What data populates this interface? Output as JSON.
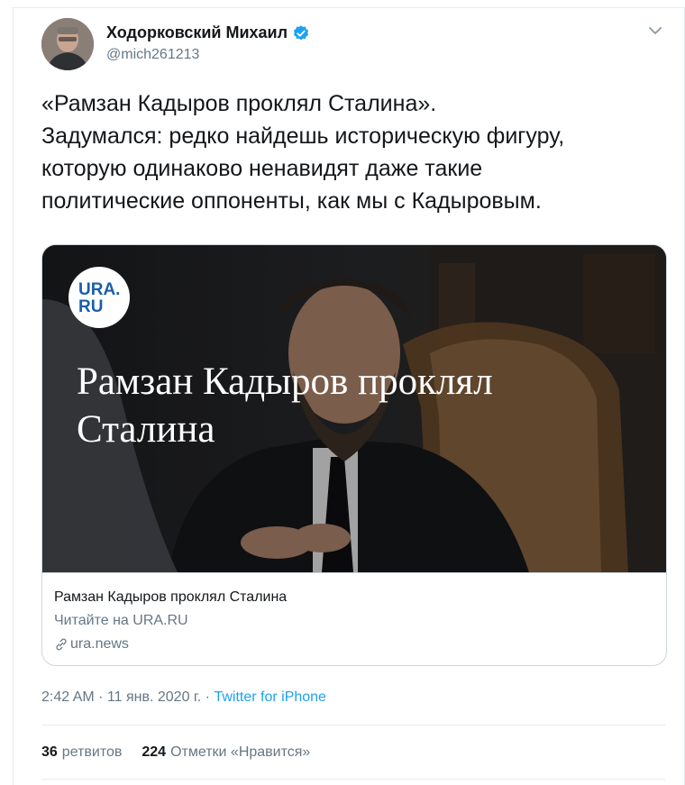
{
  "author": {
    "name": "Ходорковский Михаил",
    "handle": "@mich261213"
  },
  "tweet": {
    "text": "«Рамзан Кадыров проклял Сталина».\nЗадумался: редко найдешь историческую фигуру,\nкоторую одинаково ненавидят даже такие\nполитические оппоненты, как мы с Кадыровым."
  },
  "card": {
    "logo_line1": "URA.",
    "logo_line2": "RU",
    "overlay_line1": "Рамзан Кадыров проклял",
    "overlay_line2": "Сталина",
    "title": "Рамзан Кадыров проклял Сталина",
    "description": "Читайте на URA.RU",
    "domain": "ura.news"
  },
  "meta": {
    "time": "2:42 AM · 11 янв. 2020 г. · ",
    "source": "Twitter for iPhone"
  },
  "stats": {
    "retweets_count": "36",
    "retweets_label": "ретвитов",
    "likes_count": "224",
    "likes_label": "Отметки «Нравится»"
  },
  "colors": {
    "accent": "#1da1f2",
    "secondary_text": "#657786",
    "border": "#e6ecf0",
    "logo_blue": "#1a5fa8"
  }
}
